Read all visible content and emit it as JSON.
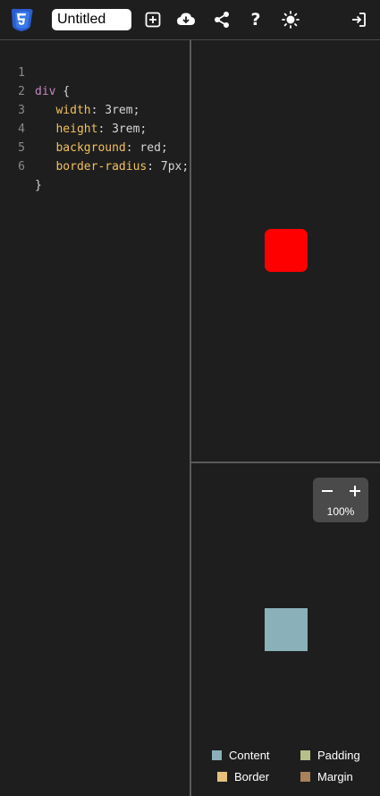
{
  "toolbar": {
    "title_value": "Untitled",
    "help_label": "?",
    "icons": [
      "css3-logo-icon",
      "add-file-icon",
      "cloud-download-icon",
      "share-icon",
      "help-icon",
      "theme-sun-icon",
      "login-icon"
    ]
  },
  "editor": {
    "lines": [
      {
        "num": "1",
        "selector": "div",
        "punct": " {"
      },
      {
        "num": "2",
        "indent": "   ",
        "prop": "width",
        "sep": ": ",
        "value": "3rem;"
      },
      {
        "num": "3",
        "indent": "   ",
        "prop": "height",
        "sep": ": ",
        "value": "3rem;"
      },
      {
        "num": "4",
        "indent": "   ",
        "prop": "background",
        "sep": ": ",
        "value": "red;"
      },
      {
        "num": "5",
        "indent": "   ",
        "prop": "border-radius",
        "sep": ": ",
        "value": "7px;"
      },
      {
        "num": "6",
        "close": "}"
      }
    ]
  },
  "preview": {
    "box_color": "#ff0000"
  },
  "boxmodel": {
    "zoom_label": "100%",
    "legend": [
      {
        "label": "Content",
        "color": "#8ab0b9"
      },
      {
        "label": "Padding",
        "color": "#b5c08a"
      },
      {
        "label": "Border",
        "color": "#e6c07e"
      },
      {
        "label": "Margin",
        "color": "#a8825a"
      }
    ]
  }
}
